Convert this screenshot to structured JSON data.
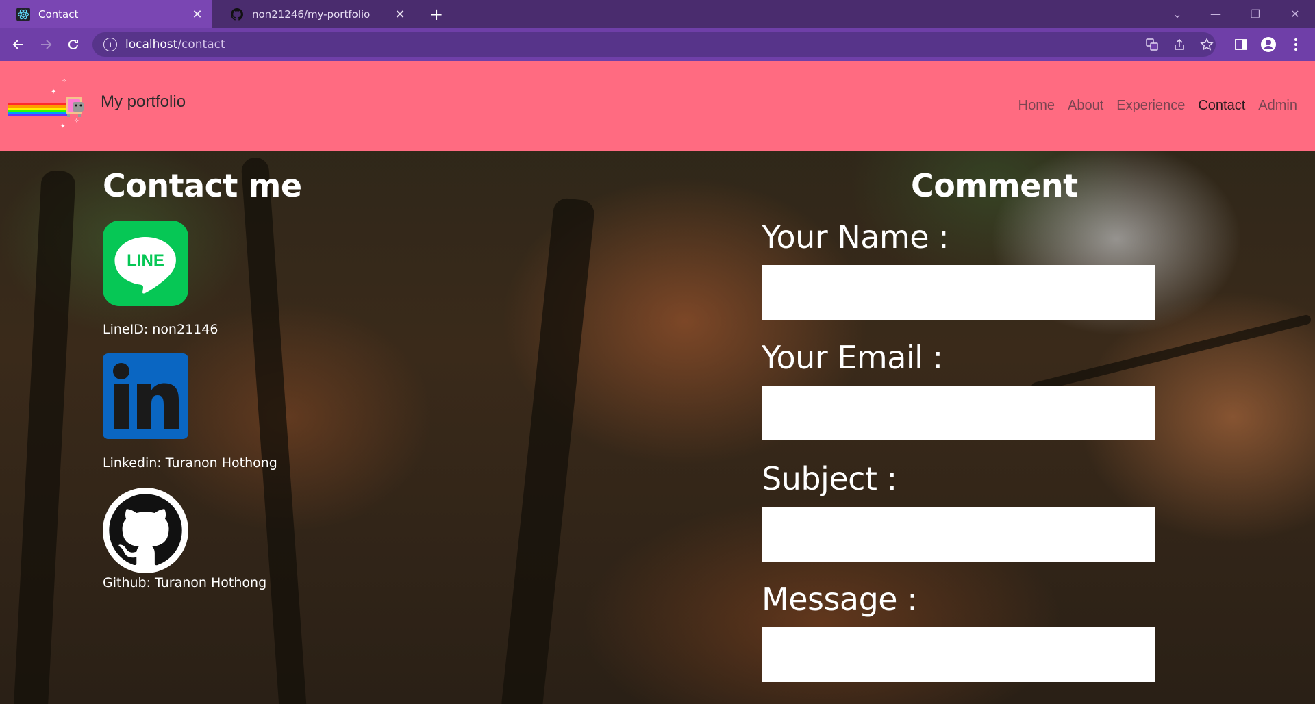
{
  "browser": {
    "tabs": [
      {
        "title": "Contact",
        "active": true,
        "icon": "react-icon"
      },
      {
        "title": "non21246/my-portfolio",
        "active": false,
        "icon": "github-icon"
      }
    ],
    "url_host": "localhost",
    "url_path": "/contact"
  },
  "navbar": {
    "brand": "My portfolio",
    "links": [
      {
        "label": "Home",
        "active": false
      },
      {
        "label": "About",
        "active": false
      },
      {
        "label": "Experience",
        "active": false
      },
      {
        "label": "Contact",
        "active": true
      },
      {
        "label": "Admin",
        "active": false
      }
    ]
  },
  "contact": {
    "title": "Contact me",
    "items": [
      {
        "icon": "line-icon",
        "label": "LineID: non21146"
      },
      {
        "icon": "linkedin-icon",
        "label": "Linkedin: Turanon Hothong"
      },
      {
        "icon": "github-icon",
        "label": "Github: Turanon Hothong"
      }
    ]
  },
  "comment": {
    "title": "Comment",
    "fields": [
      {
        "label": "Your Name :",
        "value": ""
      },
      {
        "label": "Your Email :",
        "value": ""
      },
      {
        "label": "Subject :",
        "value": ""
      },
      {
        "label": "Message :",
        "value": ""
      }
    ]
  },
  "colors": {
    "navbar_bg": "#ff6b81",
    "tabbar_bg": "#4a2c6e",
    "toolbar_bg": "#6f3fa8",
    "line_green": "#06c755",
    "linkedin_blue": "#0a66c2"
  }
}
